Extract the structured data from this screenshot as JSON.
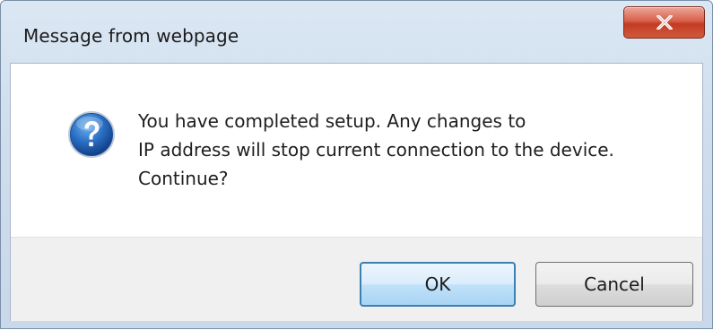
{
  "dialog": {
    "title": "Message from webpage",
    "close_icon": "close-x-icon",
    "message_icon": "question-icon",
    "message": "You have completed setup. Any changes to\nIP address will stop current connection to the device.\nContinue?",
    "buttons": {
      "ok_label": "OK",
      "cancel_label": "Cancel"
    },
    "colors": {
      "close_button": "#c9432b",
      "ok_border": "#3c7fb1",
      "question_icon": "#1f5fa8"
    }
  }
}
